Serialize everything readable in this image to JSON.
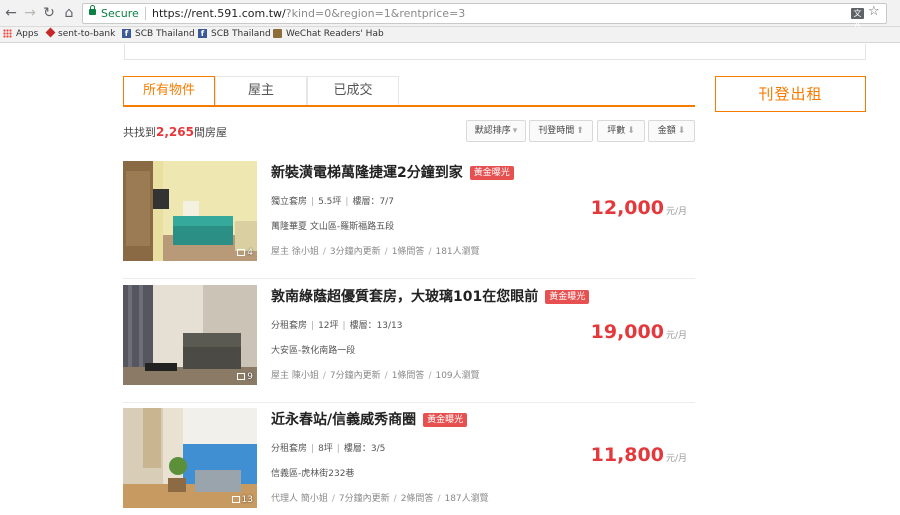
{
  "browser": {
    "secure_label": "Secure",
    "url_host": "https://rent.591.com.tw/",
    "url_query": "?kind=0&region=1&rentprice=3",
    "translate_label": "文A"
  },
  "bookmarks": [
    {
      "label": "Apps"
    },
    {
      "label": "sent-to-bank"
    },
    {
      "label": "SCB Thailand"
    },
    {
      "label": "SCB Thailand"
    },
    {
      "label": "WeChat Readers' Hab"
    }
  ],
  "tabs": [
    {
      "label": "所有物件",
      "active": true
    },
    {
      "label": "屋主",
      "active": false
    },
    {
      "label": "已成交",
      "active": false
    }
  ],
  "post_button": "刊登出租",
  "results": {
    "prefix": "共找到",
    "count": "2,265",
    "suffix": "間房屋"
  },
  "sort": [
    {
      "label": "默認排序",
      "arrow": "▾"
    },
    {
      "label": "刊登時間",
      "arrow": "⬆"
    },
    {
      "label": "坪數",
      "arrow": "⬇"
    },
    {
      "label": "金額",
      "arrow": "⬇"
    }
  ],
  "listings": [
    {
      "title": "新裝潢電梯萬隆捷運2分鐘到家",
      "badge": "黃金曝光",
      "type": "獨立套房",
      "size": "5.5坪",
      "floor": "樓層：7/7",
      "address": "萬隆華夏 文山區-羅斯福路五段",
      "owner": "屋主 徐小姐",
      "updated": "3分鐘內更新",
      "questions": "1條問答",
      "views": "181人瀏覽",
      "price": "12,000",
      "unit": "元/月",
      "photos": "4"
    },
    {
      "title": "敦南綠蔭超優質套房，大玻璃101在您眼前",
      "badge": "黃金曝光",
      "type": "分租套房",
      "size": "12坪",
      "floor": "樓層：13/13",
      "address": "大安區-敦化南路一段",
      "owner": "屋主 陳小姐",
      "updated": "7分鐘內更新",
      "questions": "1條問答",
      "views": "109人瀏覽",
      "price": "19,000",
      "unit": "元/月",
      "photos": "9"
    },
    {
      "title": "近永春站/信義威秀商圈",
      "badge": "黃金曝光",
      "type": "分租套房",
      "size": "8坪",
      "floor": "樓層：3/5",
      "address": "信義區-虎林街232巷",
      "owner": "代理人 簡小姐",
      "updated": "7分鐘內更新",
      "questions": "2條問答",
      "views": "187人瀏覽",
      "price": "11,800",
      "unit": "元/月",
      "photos": "13"
    }
  ]
}
